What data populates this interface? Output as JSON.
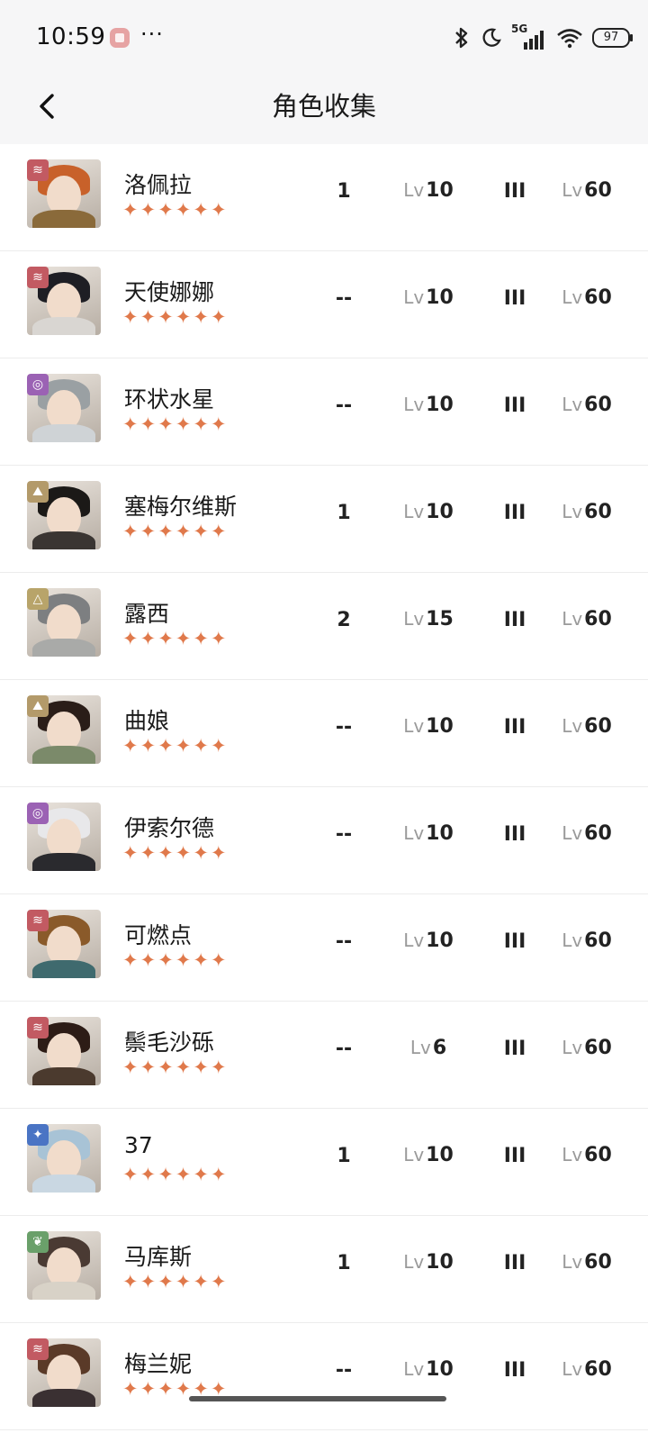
{
  "status_bar": {
    "time": "10:59",
    "more": "···",
    "network": "5G",
    "battery": "97"
  },
  "header": {
    "title": "角色收集"
  },
  "level_prefix": "Lv",
  "stars_text": "✦✦✦✦✦✦",
  "rows": [
    {
      "name": "洛佩拉",
      "rank": "1",
      "level": "10",
      "tier": "III",
      "max_level": "60",
      "badge": "arcanist-wave",
      "badge_color": "#c25a62",
      "hair_color": "#c8612a",
      "body_color": "#8a6a3a"
    },
    {
      "name": "天使娜娜",
      "rank": "--",
      "level": "10",
      "tier": "III",
      "max_level": "60",
      "badge": "arcanist-wave",
      "badge_color": "#c25a62",
      "hair_color": "#1e1e24",
      "body_color": "#d9d6d2"
    },
    {
      "name": "环状水星",
      "rank": "--",
      "level": "10",
      "tier": "III",
      "max_level": "60",
      "badge": "arcanist-ring",
      "badge_color": "#9b62b4",
      "hair_color": "#9aa0a3",
      "body_color": "#cfd3d6"
    },
    {
      "name": "塞梅尔维斯",
      "rank": "1",
      "level": "10",
      "tier": "III",
      "max_level": "60",
      "badge": "arcanist-mineral",
      "badge_color": "#b39a6a",
      "hair_color": "#1b1917",
      "body_color": "#3a3532"
    },
    {
      "name": "露西",
      "rank": "2",
      "level": "15",
      "tier": "III",
      "max_level": "60",
      "badge": "arcanist-triangle",
      "badge_color": "#b8a46a",
      "hair_color": "#7d7f81",
      "body_color": "#a9aaa8"
    },
    {
      "name": "曲娘",
      "rank": "--",
      "level": "10",
      "tier": "III",
      "max_level": "60",
      "badge": "arcanist-mineral",
      "badge_color": "#b39a6a",
      "hair_color": "#2a1d18",
      "body_color": "#7b8a6a"
    },
    {
      "name": "伊索尔德",
      "rank": "--",
      "level": "10",
      "tier": "III",
      "max_level": "60",
      "badge": "arcanist-ring",
      "badge_color": "#9b62b4",
      "hair_color": "#e8e8ea",
      "body_color": "#2a2a2e"
    },
    {
      "name": "可燃点",
      "rank": "--",
      "level": "10",
      "tier": "III",
      "max_level": "60",
      "badge": "arcanist-wave",
      "badge_color": "#c25a62",
      "hair_color": "#8a5a2a",
      "body_color": "#3f6a6e"
    },
    {
      "name": "鬃毛沙砾",
      "rank": "--",
      "level": "6",
      "tier": "III",
      "max_level": "60",
      "badge": "arcanist-wave",
      "badge_color": "#c25a62",
      "hair_color": "#2d1c16",
      "body_color": "#4b3a2e"
    },
    {
      "name": "37",
      "rank": "1",
      "level": "10",
      "tier": "III",
      "max_level": "60",
      "badge": "arcanist-star",
      "badge_color": "#4a74c4",
      "hair_color": "#a8c3d6",
      "body_color": "#c9d7e2"
    },
    {
      "name": "马库斯",
      "rank": "1",
      "level": "10",
      "tier": "III",
      "max_level": "60",
      "badge": "arcanist-leaf",
      "badge_color": "#6aa06a",
      "hair_color": "#4a3a33",
      "body_color": "#d8d2c7"
    },
    {
      "name": "梅兰妮",
      "rank": "--",
      "level": "10",
      "tier": "III",
      "max_level": "60",
      "badge": "arcanist-wave",
      "badge_color": "#c25a62",
      "hair_color": "#5a3a28",
      "body_color": "#3a3032"
    }
  ]
}
